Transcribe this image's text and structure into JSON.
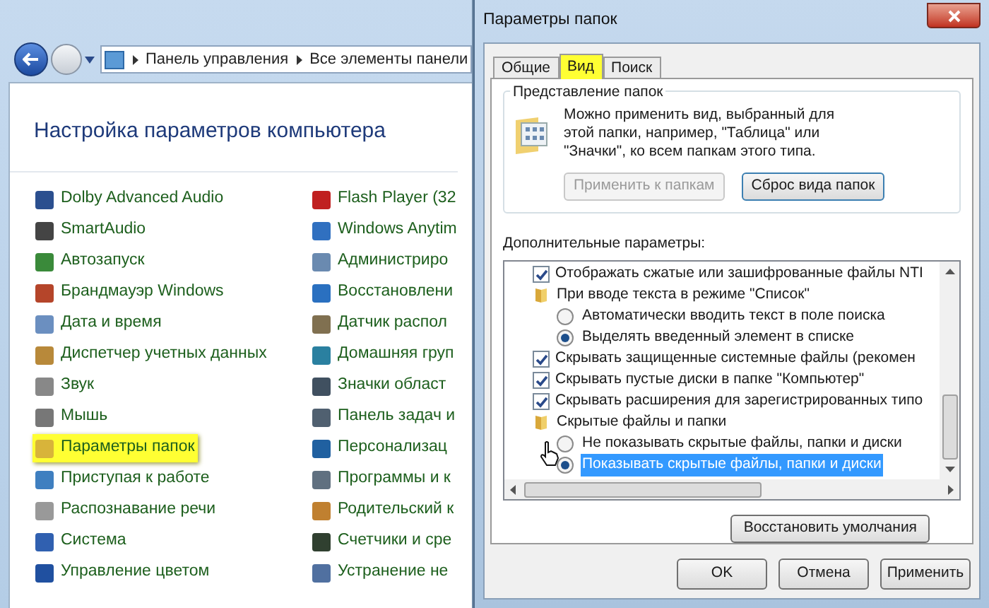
{
  "explorer": {
    "breadcrumb": [
      "Панель управления",
      "Все элементы панели"
    ],
    "heading": "Настройка параметров компьютера",
    "left_items": [
      {
        "label": "Dolby Advanced Audio",
        "highlighted": false
      },
      {
        "label": "SmartAudio",
        "highlighted": false
      },
      {
        "label": "Автозапуск",
        "highlighted": false
      },
      {
        "label": "Брандмауэр Windows",
        "highlighted": false
      },
      {
        "label": "Дата и время",
        "highlighted": false
      },
      {
        "label": "Диспетчер учетных данных",
        "highlighted": false
      },
      {
        "label": "Звук",
        "highlighted": false
      },
      {
        "label": "Мышь",
        "highlighted": false
      },
      {
        "label": "Параметры папок",
        "highlighted": true
      },
      {
        "label": "Приступая к работе",
        "highlighted": false
      },
      {
        "label": "Распознавание речи",
        "highlighted": false
      },
      {
        "label": "Система",
        "highlighted": false
      },
      {
        "label": "Управление цветом",
        "highlighted": false
      }
    ],
    "right_items": [
      "Flash Player (32",
      "Windows Anytim",
      "Администриро",
      "Восстановлени",
      "Датчик распол",
      "Домашняя груп",
      "Значки област",
      "Панель задач и",
      "Персонализац",
      "Программы и к",
      "Родительский к",
      "Счетчики и сре",
      "Устранение не"
    ]
  },
  "dialog": {
    "title": "Параметры папок",
    "tabs": [
      {
        "label": "Общие",
        "selected": false
      },
      {
        "label": "Вид",
        "selected": true
      },
      {
        "label": "Поиск",
        "selected": false
      }
    ],
    "folder_views": {
      "title": "Представление папок",
      "text": "Можно применить вид, выбранный для этой папки, например, \"Таблица\" или \"Значки\", ко всем папкам этого типа.",
      "buttons": [
        {
          "label": "Применить к папкам",
          "disabled": true
        },
        {
          "label": "Сброс вида папок",
          "disabled": false
        }
      ]
    },
    "advanced": {
      "label": "Дополнительные параметры:",
      "items": [
        {
          "kind": "checkbox",
          "label": "Отображать сжатые или зашифрованные файлы NTI",
          "checked": true
        },
        {
          "kind": "group",
          "label": "При вводе текста в режиме \"Список\"",
          "children": [
            {
              "kind": "radio",
              "label": "Автоматически вводить текст в поле поиска",
              "selected": false,
              "highlighted": false
            },
            {
              "kind": "radio",
              "label": "Выделять введенный элемент в списке",
              "selected": true,
              "highlighted": false
            }
          ]
        },
        {
          "kind": "checkbox",
          "label": "Скрывать защищенные системные файлы (рекомен",
          "checked": true
        },
        {
          "kind": "checkbox",
          "label": "Скрывать пустые диски в папке \"Компьютер\"",
          "checked": true
        },
        {
          "kind": "checkbox",
          "label": "Скрывать расширения для зарегистрированных типо",
          "checked": true
        },
        {
          "kind": "group",
          "label": "Скрытые файлы и папки",
          "children": [
            {
              "kind": "radio",
              "label": "Не показывать скрытые файлы, папки и диски",
              "selected": false,
              "highlighted": false
            },
            {
              "kind": "radio",
              "label": "Показывать скрытые файлы, папки и диски",
              "selected": true,
              "highlighted": true
            }
          ]
        }
      ]
    },
    "restore_button": "Восстановить умолчания",
    "buttons": [
      "OK",
      "Отмена",
      "Применить"
    ]
  }
}
